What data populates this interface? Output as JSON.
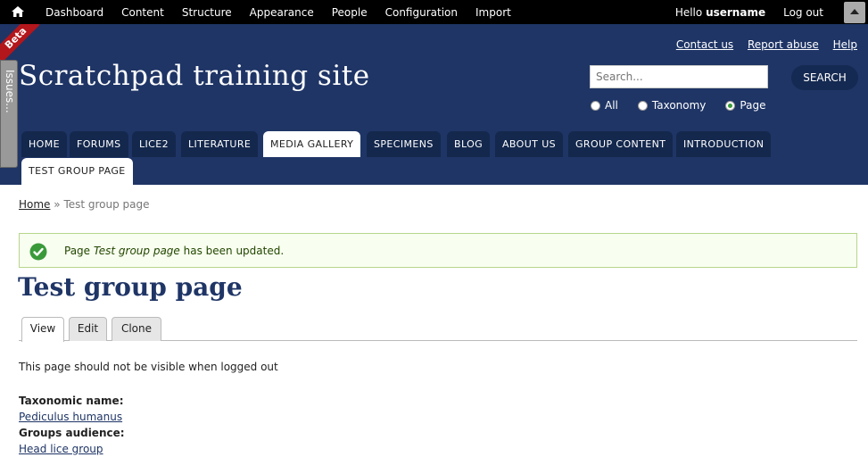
{
  "toolbar": {
    "items": [
      "Dashboard",
      "Content",
      "Structure",
      "Appearance",
      "People",
      "Configuration",
      "Import"
    ],
    "hello_prefix": "Hello",
    "username": "username",
    "logout": "Log out"
  },
  "header": {
    "beta_label": "Beta",
    "issues_label": "Issues...",
    "top_links": [
      "Contact us",
      "Report abuse",
      "Help"
    ],
    "site_name": "Scratchpad training site",
    "search_placeholder": "Search...",
    "search_button": "SEARCH",
    "radio_options": [
      {
        "label": "All",
        "selected": false
      },
      {
        "label": "Taxonomy",
        "selected": false
      },
      {
        "label": "Page",
        "selected": true
      }
    ]
  },
  "nav": {
    "tabs": [
      "Home",
      "Forums",
      "Lice2",
      "Literature",
      "Media gallery",
      "Specimens",
      "Blog",
      "About us",
      "Group content",
      "Introduction"
    ],
    "current_tab": "Test group page",
    "active_tab": "Media gallery"
  },
  "breadcrumb": {
    "home": "Home",
    "separator": "»",
    "current": "Test group page"
  },
  "message": {
    "prefix": "Page",
    "node_title": "Test group page",
    "suffix": "has been updated."
  },
  "page": {
    "title": "Test group page",
    "tabs": [
      "View",
      "Edit",
      "Clone"
    ],
    "active_tab": "View",
    "body": "This page should not be visible when logged out",
    "taxonomic_name_label": "Taxonomic name:",
    "taxonomic_name_value": "Pediculus humanus",
    "groups_audience_label": "Groups audience:",
    "groups_audience_value": "Head lice group"
  },
  "colors": {
    "header_bg": "#1f3566",
    "nav_tab_bg": "#14284d",
    "toolbar_bg": "#000000",
    "message_bg": "#f8fff0",
    "message_border": "#b8d68c",
    "success_green": "#3a9a3a",
    "ribbon_red": "#b3161b"
  }
}
